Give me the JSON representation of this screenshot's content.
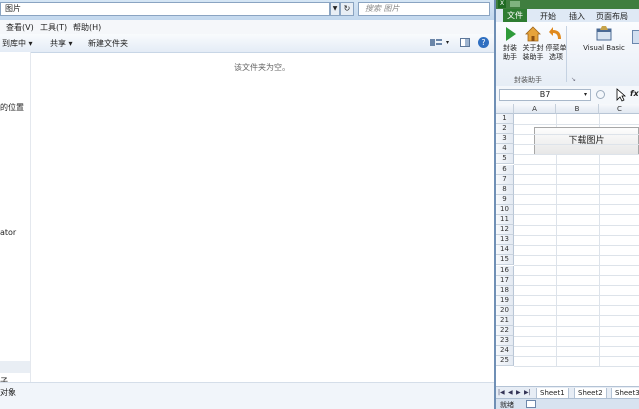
{
  "explorer": {
    "address_path": "图片",
    "search_placeholder": "搜索 图片",
    "menu": [
      "查看(V)",
      "工具(T)",
      "帮助(H)"
    ],
    "toolbar": {
      "include_library": "到库中 ▾",
      "share": "共享 ▾",
      "new_folder": "新建文件夹"
    },
    "empty_message": "该文件夹为空。",
    "nav_fragments": [
      "的位置",
      "ator",
      "子"
    ],
    "status_text": "对象"
  },
  "excel": {
    "tabs": {
      "file": "文件",
      "home": "开始",
      "insert": "插入",
      "page_layout": "页面布局"
    },
    "ribbon": {
      "buttons": [
        {
          "label": "封装\n助手",
          "icon": "play-icon"
        },
        {
          "label": "关于封\n装助手",
          "icon": "home-icon"
        },
        {
          "label": "停菜单\n选项",
          "icon": "undo-icon"
        },
        {
          "label": "Visual Basic",
          "icon": "vb-icon"
        }
      ],
      "group_label": "封装助手"
    },
    "name_box": "B7",
    "fx": "fx",
    "columns": [
      "A",
      "B",
      "C"
    ],
    "rows": [
      "1",
      "2",
      "3",
      "4",
      "5",
      "6",
      "7",
      "8",
      "9",
      "10",
      "11",
      "12",
      "13",
      "14",
      "15",
      "16",
      "17",
      "18",
      "19",
      "20",
      "21",
      "22",
      "23",
      "24",
      "25"
    ],
    "button_label": "下载图片",
    "sheets": [
      "Sheet1",
      "Sheet2",
      "Sheet3"
    ],
    "status": "就绪"
  }
}
